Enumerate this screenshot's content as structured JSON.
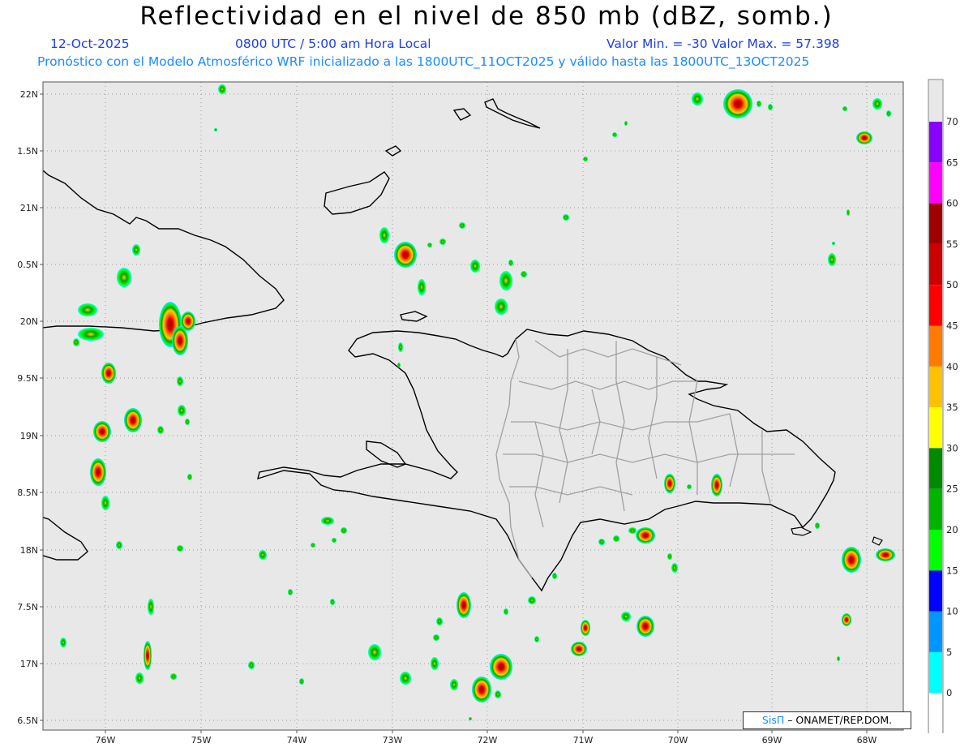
{
  "header": {
    "title": "Reflectividad en el nivel de 850 mb (dBZ, somb.)",
    "date": "12-Oct-2025",
    "time": "0800 UTC / 5:00 am Hora Local",
    "minmax": "Valor Min. = -30  Valor Max. = 57.398",
    "forecast": "Pronóstico con el Modelo Atmosférico WRF inicializado a las 1800UTC_11OCT2025 y válido hasta las  1800UTC_13OCT2025"
  },
  "axes": {
    "lat_labels": [
      "22N",
      "1.5N",
      "21N",
      "0.5N",
      "20N",
      "9.5N",
      "19N",
      "8.5N",
      "18N",
      "7.5N",
      "17N",
      "6.5N"
    ],
    "lon_labels": [
      "76W",
      "75W",
      "74W",
      "73W",
      "72W",
      "71W",
      "70W",
      "69W",
      "68W"
    ]
  },
  "colorbar": {
    "labels": [
      "70",
      "65",
      "60",
      "55",
      "50",
      "45",
      "40",
      "35",
      "30",
      "25",
      "20",
      "15",
      "10",
      "5",
      "0"
    ],
    "colors": [
      "#8a00ff",
      "#ff00ff",
      "#a00000",
      "#cc0000",
      "#ff0000",
      "#ff7a00",
      "#ffc000",
      "#ffff00",
      "#008a00",
      "#00b400",
      "#00ff00",
      "#0000ff",
      "#0096ff",
      "#00ffff",
      "#ffffff"
    ]
  },
  "credit": {
    "brand": "SisΠ",
    "org": " – ONAMET/REP.DOM."
  }
}
